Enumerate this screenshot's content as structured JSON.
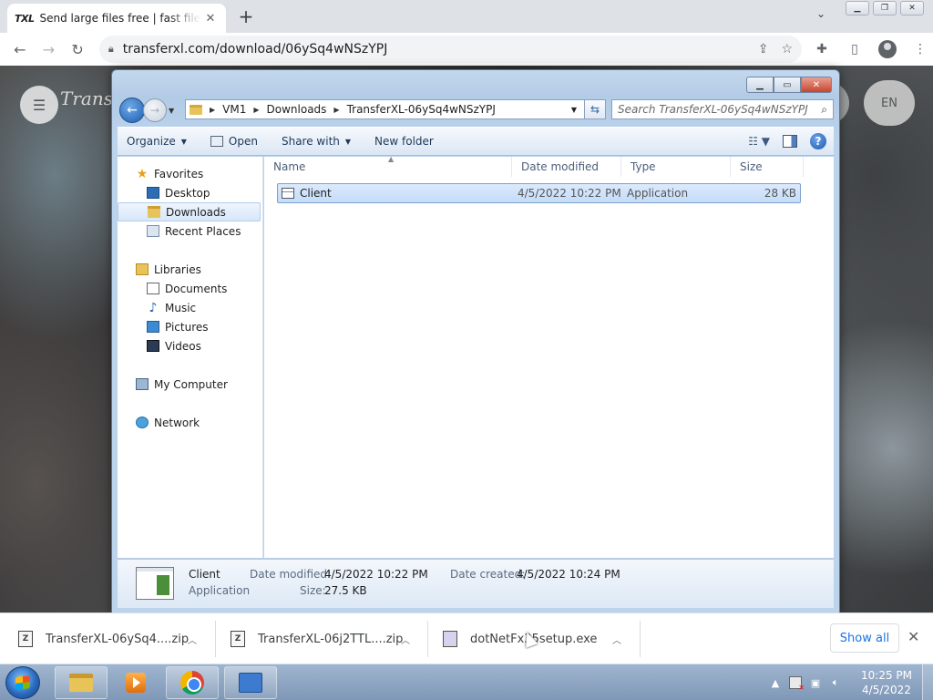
{
  "browser": {
    "tab": {
      "favicon_text": "TXL",
      "title": "Send large files free | fast file transfer"
    },
    "address": "transferxl.com/download/06ySq4wNSzYPJ"
  },
  "site": {
    "logo_text": "Transf",
    "lang_label": "EN"
  },
  "explorer": {
    "breadcrumbs": [
      "VM1",
      "Downloads",
      "TransferXL-06ySq4wNSzYPJ"
    ],
    "search_placeholder": "Search TransferXL-06ySq4wNSzYPJ",
    "commands": {
      "organize": "Organize",
      "open": "Open",
      "share_with": "Share with",
      "new_folder": "New folder"
    },
    "nav": {
      "favorites": "Favorites",
      "desktop": "Desktop",
      "downloads": "Downloads",
      "recent_places": "Recent Places",
      "libraries": "Libraries",
      "documents": "Documents",
      "music": "Music",
      "pictures": "Pictures",
      "videos": "Videos",
      "my_computer": "My Computer",
      "network": "Network"
    },
    "columns": {
      "name": "Name",
      "date_modified": "Date modified",
      "type": "Type",
      "size": "Size"
    },
    "files": [
      {
        "name": "Client",
        "date_modified": "4/5/2022 10:22 PM",
        "type": "Application",
        "size": "28 KB"
      }
    ],
    "details": {
      "name": "Client",
      "type": "Application",
      "date_modified_label": "Date modified:",
      "date_modified": "4/5/2022 10:22 PM",
      "date_created_label": "Date created:",
      "date_created": "4/5/2022 10:24 PM",
      "size_label": "Size:",
      "size": "27.5 KB"
    }
  },
  "downloads": {
    "items": [
      "TransferXL-06ySq4....zip",
      "TransferXL-06j2TTL....zip",
      "dotNetFx35setup.exe"
    ],
    "show_all": "Show all"
  },
  "taskbar": {
    "time": "10:25 PM",
    "date": "4/5/2022"
  }
}
